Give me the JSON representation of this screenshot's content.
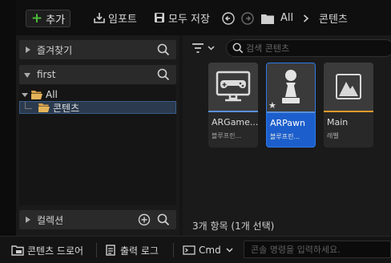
{
  "toolbar": {
    "add_label": "추가",
    "import_label": "임포트",
    "save_all_label": "모두 저장",
    "breadcrumb_all": "All",
    "breadcrumb_content": "콘텐츠"
  },
  "sidebar": {
    "favorites_label": "즐겨찾기",
    "project_label": "first",
    "tree": [
      {
        "label": "All"
      },
      {
        "label": "콘텐츠"
      }
    ],
    "collections_label": "컬렉션"
  },
  "search": {
    "placeholder": "검색 콘텐츠"
  },
  "assets": [
    {
      "name": "ARGame...",
      "type": "블루프린...",
      "icon": "gamepad-icon",
      "bar_color": "#5a8fd8",
      "selected": false
    },
    {
      "name": "ARPawn",
      "type": "블루프린...",
      "icon": "pawn-icon",
      "bar_color": "#5a8fd8",
      "selected": true
    },
    {
      "name": "Main",
      "type": "레벨",
      "icon": "level-icon",
      "bar_color": "#e89a2c",
      "selected": false
    }
  ],
  "status": "3개 항목 (1개 선택)",
  "bottombar": {
    "content_drawer_label": "콘텐츠 드로어",
    "output_log_label": "출력 로그",
    "cmd_label": "Cmd",
    "console_placeholder": "콘솔 명령을 입력하세요."
  },
  "colors": {
    "accent": "#2f7ae5",
    "folder": "#d9a04a",
    "add_plus": "#4cbb3a"
  }
}
